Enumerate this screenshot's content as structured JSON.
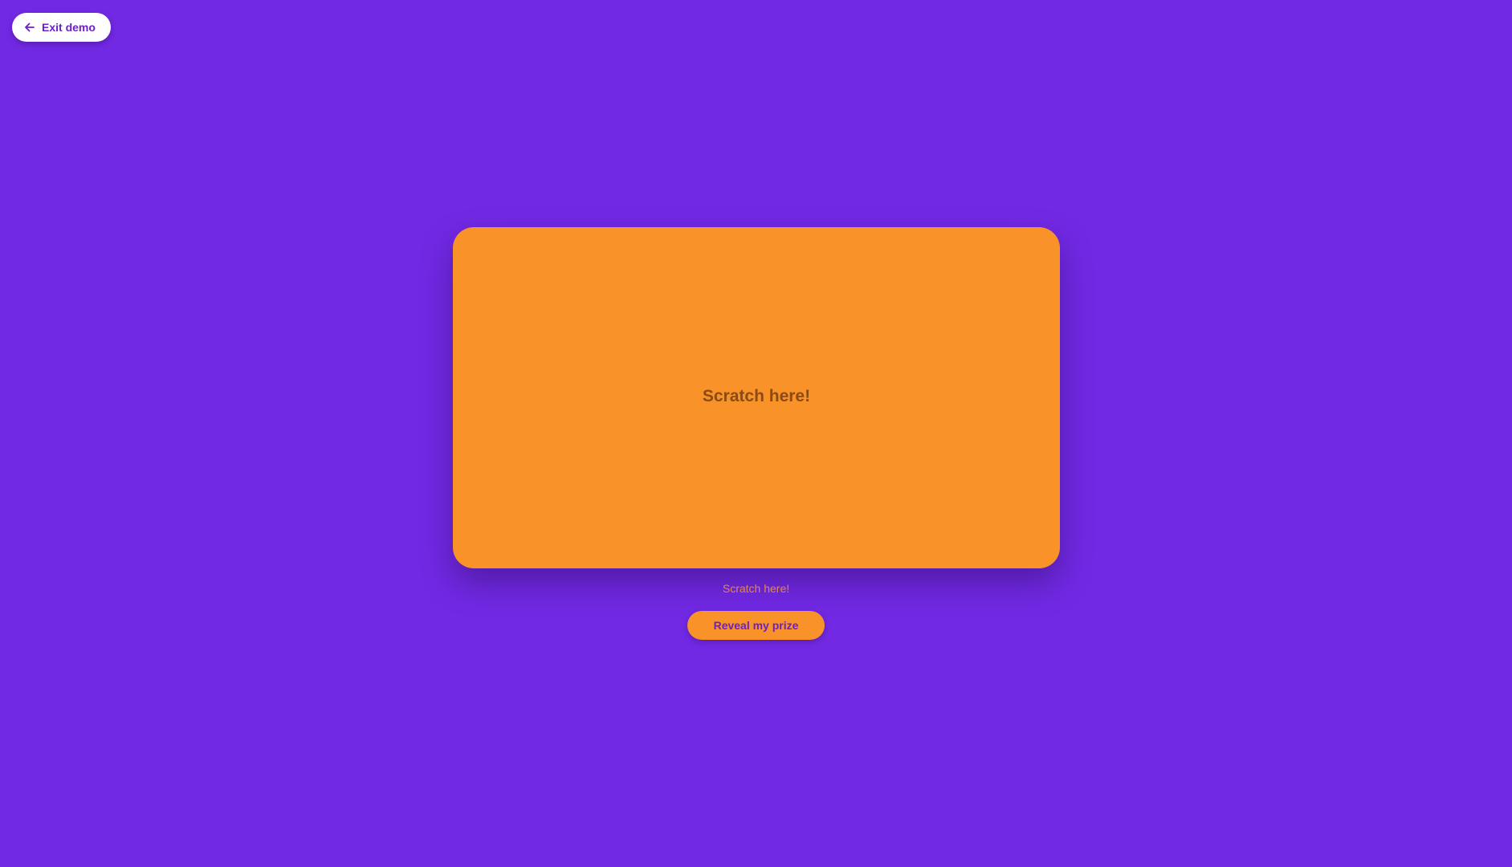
{
  "colors": {
    "background": "#7229e4",
    "card": "#f89229",
    "accent_text": "#6b21c8"
  },
  "header": {
    "exit_label": "Exit demo",
    "exit_icon": "arrow-left-icon"
  },
  "card": {
    "overlay_text": "Scratch here!"
  },
  "hint_text": "Scratch here!",
  "reveal_label": "Reveal my prize"
}
